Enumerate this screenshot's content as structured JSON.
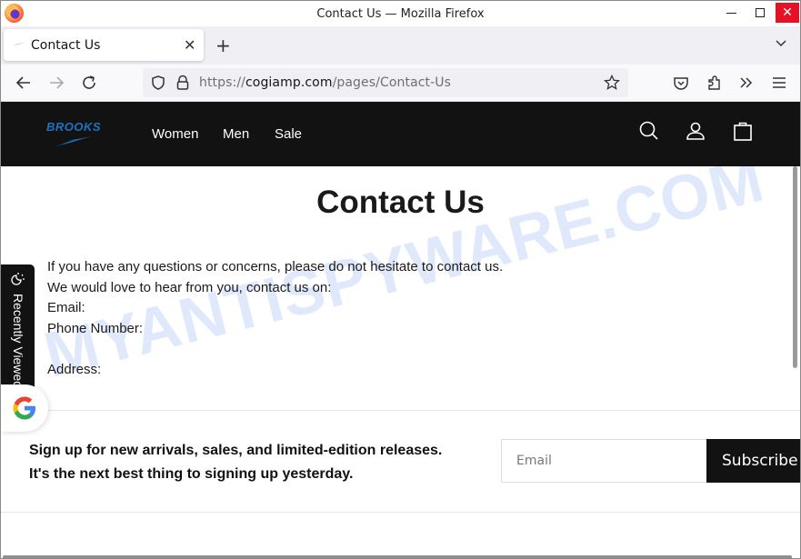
{
  "window": {
    "title": "Contact Us — Mozilla Firefox"
  },
  "tabs": [
    {
      "label": "Contact Us",
      "active": true
    }
  ],
  "navbar": {
    "url_scheme": "https://",
    "url_host": "cogiamp.com",
    "url_path": "/pages/Contact-Us"
  },
  "site": {
    "brand": "BROOKS",
    "brand_color": "#1e72c0",
    "nav": [
      "Women",
      "Men",
      "Sale"
    ]
  },
  "page": {
    "title": "Contact Us",
    "lines": [
      "If you have any questions or concerns, please do not hesitate to contact us.",
      "We would love to hear from you, contact us on:",
      "Email:",
      "Phone Number:",
      "",
      "Address:"
    ]
  },
  "signup": {
    "text": "Sign up for new arrivals, sales, and limited-edition releases. It's the next best thing to signing up yesterday.",
    "email_placeholder": "Email",
    "subscribe_label": "Subscribe"
  },
  "recently_viewed": {
    "label": "Recently Viewed"
  },
  "watermark": "MYANTISPYWARE.COM"
}
